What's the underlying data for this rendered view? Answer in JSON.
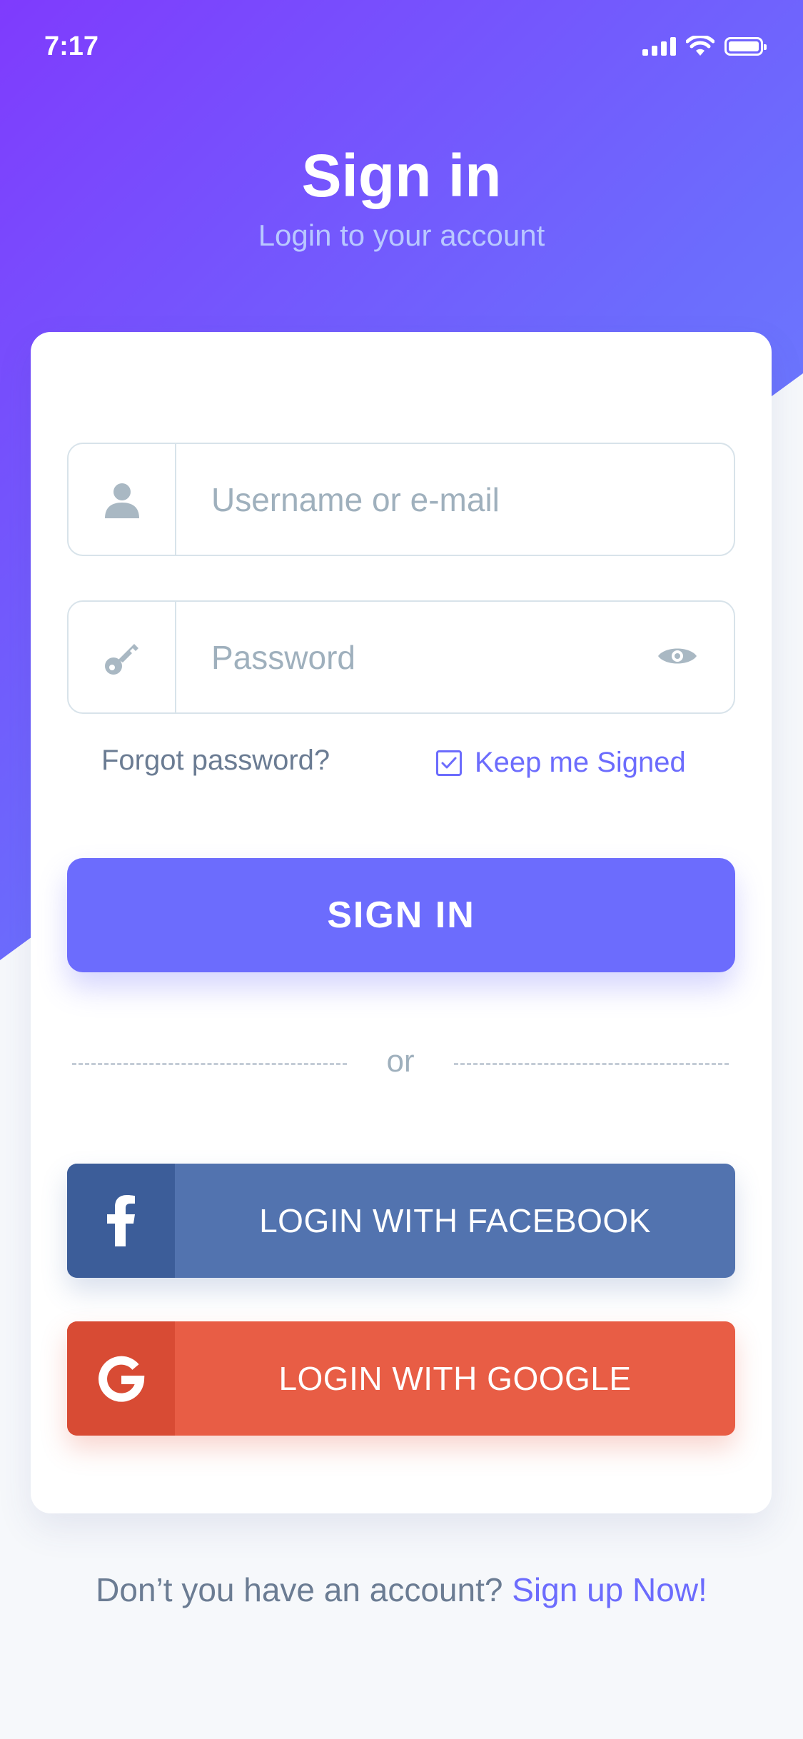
{
  "status_bar": {
    "time": "7:17"
  },
  "header": {
    "title": "Sign in",
    "subtitle": "Login to your account"
  },
  "form": {
    "username_placeholder": "Username or e-mail",
    "password_placeholder": "Password",
    "forgot_password": "Forgot password?",
    "keep_signed": "Keep me Signed",
    "keep_signed_checked": true,
    "signin_button": "SIGN IN",
    "divider_text": "or"
  },
  "social": {
    "facebook_label": "LOGIN WITH FACEBOOK",
    "google_label": "LOGIN WITH GOOGLE"
  },
  "footer": {
    "prompt": "Don’t you have an account?",
    "signup_link": "Sign up Now!"
  },
  "colors": {
    "accent": "#6c6cfd",
    "gradient_start": "#7f3bfd",
    "gradient_end": "#6a8dff",
    "facebook": "#5273af",
    "google": "#e85d45"
  },
  "icons": [
    "signal-icon",
    "wifi-icon",
    "battery-icon",
    "user-icon",
    "key-icon",
    "eye-icon",
    "check-icon",
    "facebook-icon",
    "google-icon"
  ]
}
